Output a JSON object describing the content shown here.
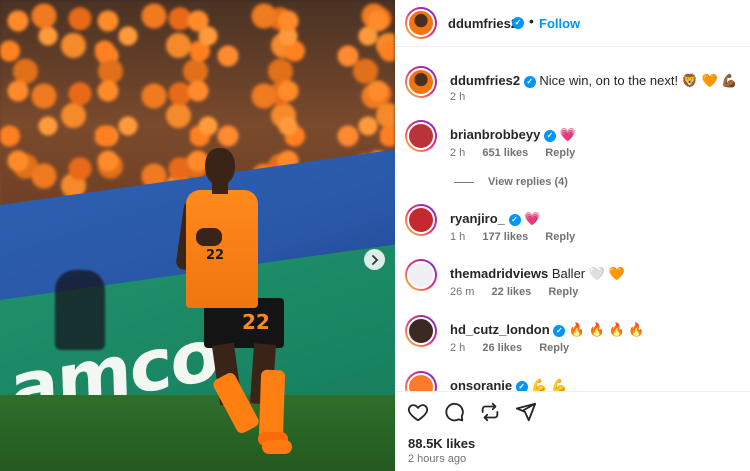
{
  "post_author": {
    "username": "ddumfries2",
    "follow_label": "Follow",
    "separator": "•"
  },
  "caption": {
    "username": "ddumfries2",
    "text": "Nice win, on to the next!",
    "emojis": "🦁 🧡 💪🏾",
    "time": "2 h"
  },
  "comments": [
    {
      "username": "brianbrobbeyy",
      "text": "",
      "emojis": "💗",
      "time": "2 h",
      "likes": "651 likes",
      "reply": "Reply",
      "avatar_color": "#b8333a"
    },
    {
      "username": "ryanjiro_",
      "text": "",
      "emojis": "💗",
      "time": "1 h",
      "likes": "177 likes",
      "reply": "Reply",
      "avatar_color": "#c4292f"
    },
    {
      "username": "themadridviews",
      "text": "Baller",
      "emojis": "🤍 🧡",
      "time": "26 m",
      "likes": "22 likes",
      "reply": "Reply",
      "avatar_color": "#eef0f4"
    },
    {
      "username": "hd_cutz_london",
      "text": "",
      "emojis": "🔥 🔥 🔥 🔥",
      "time": "2 h",
      "likes": "26 likes",
      "reply": "Reply",
      "avatar_color": "#3a2a22"
    },
    {
      "username": "onsoranie",
      "text": "",
      "emojis": "💪 💪",
      "time": "",
      "likes": "",
      "reply": "",
      "avatar_color": "#ff7a2a"
    }
  ],
  "view_replies": "View replies (4)",
  "post_stats": {
    "likes": "88.5K likes",
    "ago": "2 hours ago"
  },
  "image": {
    "jersey_number": "22",
    "ad_text": "amco"
  },
  "colors": {
    "accent": "#0095f6",
    "heart": "#ed4956",
    "text": "#262626",
    "muted": "#737373"
  },
  "icons": [
    "heart-icon",
    "comment-icon",
    "repost-icon",
    "share-icon",
    "chevron-right-icon",
    "verified-icon"
  ]
}
